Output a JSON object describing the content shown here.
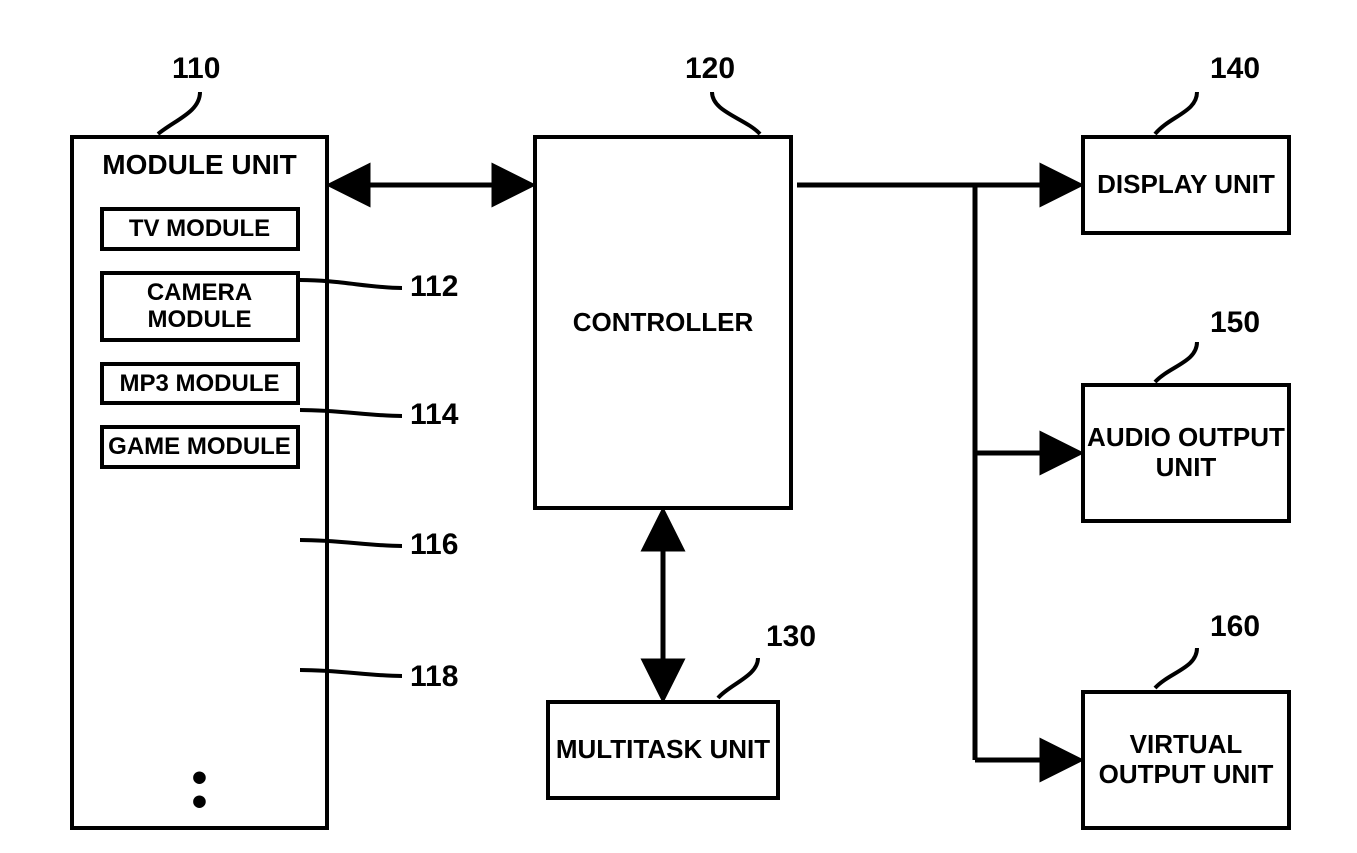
{
  "labels": {
    "module_unit": "110",
    "tv_module": "112",
    "camera_module": "114",
    "mp3_module": "116",
    "game_module": "118",
    "controller": "120",
    "multitask_unit": "130",
    "display_unit": "140",
    "audio_output_unit": "150",
    "virtual_output_unit": "160"
  },
  "blocks": {
    "module_unit": {
      "title": "MODULE UNIT"
    },
    "tv_module": "TV MODULE",
    "camera_module": "CAMERA MODULE",
    "mp3_module": "MP3 MODULE",
    "game_module": "GAME MODULE",
    "controller": "CONTROLLER",
    "multitask_unit": "MULTITASK UNIT",
    "display_unit": "DISPLAY UNIT",
    "audio_output_unit": "AUDIO OUTPUT UNIT",
    "virtual_output_unit": "VIRTUAL OUTPUT UNIT"
  },
  "ellipsis": "•\n•"
}
